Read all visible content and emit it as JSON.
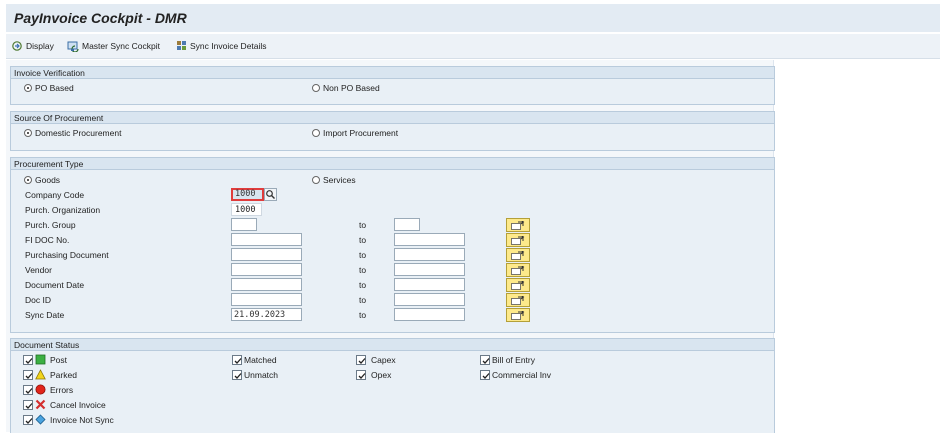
{
  "app": {
    "title": "PayInvoice Cockpit - DMR"
  },
  "toolbar": {
    "display": "Display",
    "master_sync": "Master Sync Cockpit",
    "sync_invoice": "Sync Invoice Details"
  },
  "invoice_verification": {
    "title": "Invoice Verification",
    "option_po": "PO Based",
    "option_non_po": "Non PO Based",
    "selected": "PO Based"
  },
  "source_procurement": {
    "title": "Source Of Procurement",
    "option_domestic": "Domestic Procurement",
    "option_import": "Import Procurement",
    "selected": "Domestic Procurement"
  },
  "procurement_type": {
    "title": "Procurement Type",
    "option_goods": "Goods",
    "option_services": "Services",
    "selected": "Goods",
    "to_label": "to",
    "suggestion": "1000",
    "fields": {
      "company_code": {
        "label": "Company Code",
        "value": "1000"
      },
      "purch_org": {
        "label": "Purch. Organization"
      },
      "purch_group": {
        "label": "Purch. Group",
        "from": "",
        "to": ""
      },
      "fi_doc": {
        "label": "FI DOC No.",
        "from": "",
        "to": ""
      },
      "purch_doc": {
        "label": "Purchasing Document",
        "from": "",
        "to": ""
      },
      "vendor": {
        "label": "Vendor",
        "from": "",
        "to": ""
      },
      "doc_date": {
        "label": "Document Date",
        "from": "",
        "to": ""
      },
      "doc_id": {
        "label": "Doc ID",
        "from": "",
        "to": ""
      },
      "sync_date": {
        "label": "Sync Date",
        "from": "21.09.2023",
        "to": ""
      }
    }
  },
  "document_status": {
    "title": "Document Status",
    "post": "Post",
    "parked": "Parked",
    "errors": "Errors",
    "cancel": "Cancel Invoice",
    "not_sync": "Invoice Not Sync",
    "matched": "Matched",
    "unmatch": "Unmatch",
    "capex": "Capex",
    "opex": "Opex",
    "bill_of_entry": "Bill of Entry",
    "commercial_inv": "Commercial Inv"
  },
  "colors": {
    "header_bg": "#e3ebf3",
    "group_bg": "#e9f0f6",
    "multi_select_bg": "#fde98a",
    "focus_border": "#e03c3c"
  }
}
